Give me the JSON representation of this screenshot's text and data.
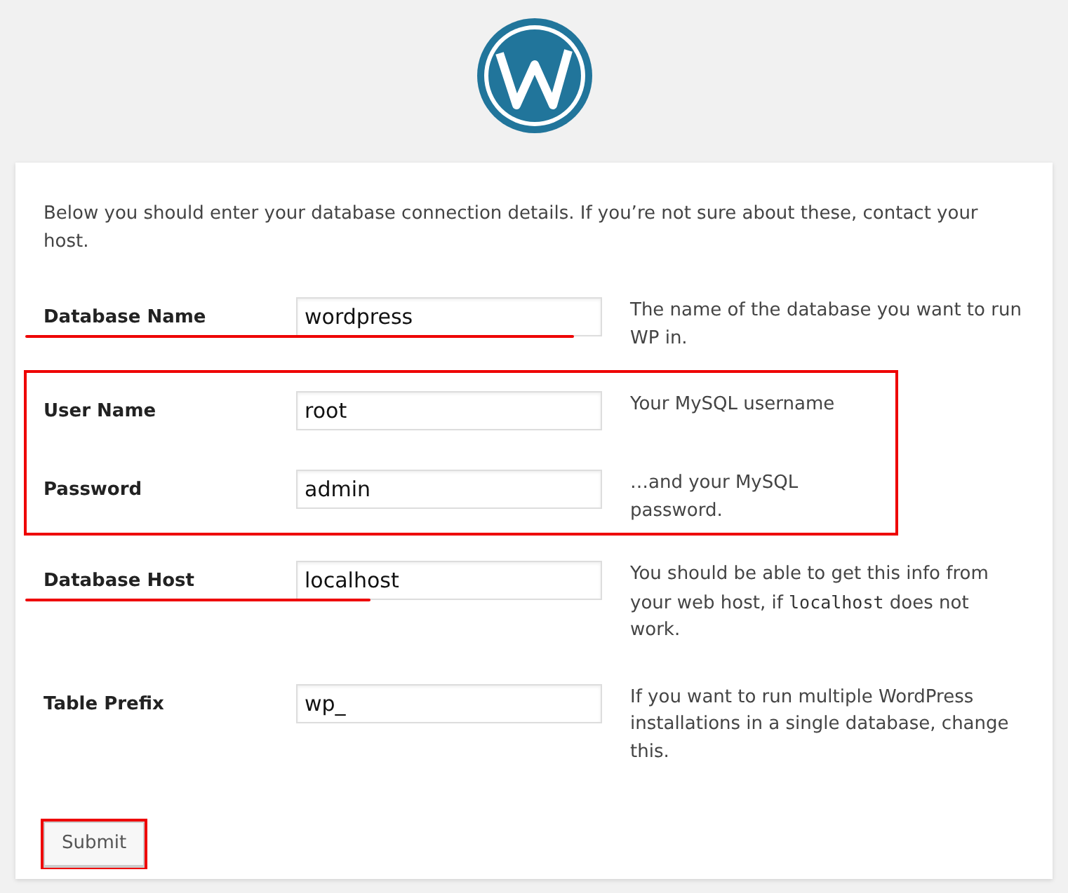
{
  "intro": "Below you should enter your database connection details. If you’re not sure about these, contact your host.",
  "groups": [
    {
      "boxed": false,
      "fields": [
        {
          "label": "Database Name",
          "value": "wordpress",
          "underlined": true,
          "help": [
            {
              "kind": "text",
              "text": "The name of the database you want to run WP in."
            }
          ]
        }
      ]
    },
    {
      "boxed": true,
      "fields": [
        {
          "label": "User Name",
          "value": "root",
          "underlined": false,
          "help": [
            {
              "kind": "text",
              "text": "Your MySQL username"
            }
          ]
        },
        {
          "label": "Password",
          "value": "admin",
          "underlined": false,
          "help": [
            {
              "kind": "text",
              "text": "…and your MySQL password."
            }
          ]
        }
      ]
    },
    {
      "boxed": false,
      "fields": [
        {
          "label": "Database Host",
          "value": "localhost",
          "underlined": true,
          "help": [
            {
              "kind": "text",
              "text": "You should be able to get this info from your web host, if "
            },
            {
              "kind": "code",
              "text": "localhost"
            },
            {
              "kind": "text",
              "text": " does not work."
            }
          ]
        },
        {
          "label": "Table Prefix",
          "value": "wp_",
          "underlined": false,
          "help": [
            {
              "kind": "text",
              "text": "If you want to run multiple WordPress installations in a single database, change this."
            }
          ]
        }
      ]
    }
  ],
  "submit": {
    "label": "Submit",
    "boxed": true
  }
}
